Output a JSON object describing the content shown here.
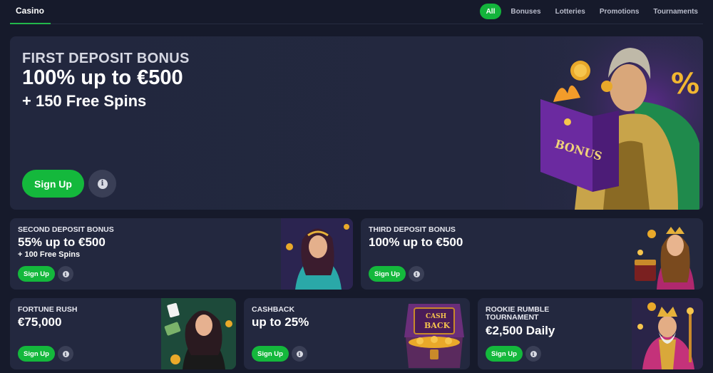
{
  "nav": {
    "brand": "Casino",
    "tabs": [
      {
        "label": "All",
        "active": true
      },
      {
        "label": "Bonuses",
        "active": false
      },
      {
        "label": "Lotteries",
        "active": false
      },
      {
        "label": "Promotions",
        "active": false
      },
      {
        "label": "Tournaments",
        "active": false
      }
    ]
  },
  "colors": {
    "background": "#161a2b",
    "card": "#23283f",
    "accent_green": "#14b83c",
    "info_button": "#3a3f56"
  },
  "hero": {
    "eyebrow": "FIRST DEPOSIT BONUS",
    "headline": "100% up to €500",
    "sub": "+ 150 Free Spins",
    "signup_label": "Sign Up",
    "info_icon": "info-icon",
    "art_book_label": "BONUS",
    "art_symbol": "%"
  },
  "promos": [
    {
      "eyebrow": "SECOND DEPOSIT BONUS",
      "headline": "55% up to €500",
      "sub": "+ 100 Free Spins",
      "signup_label": "Sign Up",
      "art": "sorceress-illustration"
    },
    {
      "eyebrow": "THIRD DEPOSIT BONUS",
      "headline": "100% up to €500",
      "sub": "",
      "signup_label": "Sign Up",
      "art": "queen-with-treasure-illustration"
    },
    {
      "eyebrow": "FORTUNE RUSH",
      "headline": "€75,000",
      "sub": "",
      "signup_label": "Sign Up",
      "art": "woman-with-cards-illustration"
    },
    {
      "eyebrow": "CASHBACK",
      "headline": "up to 25%",
      "sub": "",
      "signup_label": "Sign Up",
      "art": "treasure-chest-illustration",
      "chest_label_1": "CASH",
      "chest_label_2": "BACK"
    },
    {
      "eyebrow": "ROOKIE RUMBLE TOURNAMENT",
      "headline": "€2,500 Daily",
      "sub": "",
      "signup_label": "Sign Up",
      "art": "king-illustration"
    }
  ]
}
